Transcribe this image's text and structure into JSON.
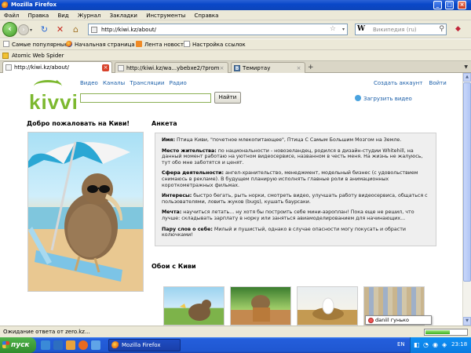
{
  "window": {
    "title": "Mozilla Firefox",
    "minimize": "_",
    "maximize": "□",
    "close": "×"
  },
  "menu": [
    "Файл",
    "Правка",
    "Вид",
    "Журнал",
    "Закладки",
    "Инструменты",
    "Справка"
  ],
  "nav": {
    "url": "http://kiwi.kz/about/",
    "search_engine": "W",
    "search_placeholder": "Википедия (ru)"
  },
  "bookmarks": [
    {
      "label": "Самые популярные",
      "icon": "page-icon"
    },
    {
      "label": "Начальная страница",
      "icon": "firefox-icon"
    },
    {
      "label": "Лента новостей",
      "icon": "rss-icon"
    },
    {
      "label": "Настройка ссылок",
      "icon": "page-icon"
    }
  ],
  "extension": {
    "label": "Atomic Web Spider"
  },
  "tabs": [
    {
      "title": "http://kiwi.kz/about/",
      "active": true
    },
    {
      "title": "http://kiwi.kz/wa...ybebxe2/?promote",
      "active": false
    },
    {
      "title": "Темиртау",
      "active": false
    }
  ],
  "page": {
    "logo": "kivvi",
    "top_nav": [
      "Видео",
      "Каналы",
      "Трансляции",
      "Радио"
    ],
    "account_links": [
      "Создать аккаунт",
      "Войти"
    ],
    "search_button": "Найти",
    "upload_link": "Загрузить видео",
    "welcome_heading": "Добро пожаловать на Киви!",
    "anketa_heading": "Анкета",
    "anketa": [
      {
        "label": "Имя:",
        "text": " Птица Киви, \"почетное млекопитающее\", Птица С Самым Большим Мозгом на Земле."
      },
      {
        "label": "Место жительства:",
        "text": " по национальности - новозеландец, родился в дизайн-студии Whitehill, на данный момент работаю на уютном видеосервисе, названном в честь меня. На жизнь не жалуюсь, тут обо мне заботятся и ценят."
      },
      {
        "label": "Сфера деятельности:",
        "text": " ангел-хранительство, менеджмент, модельный бизнес (с удовольствием снимаюсь в рекламе). В будущем планирую исполнять главные роли в анимационных короткометражных фильмах."
      },
      {
        "label": "Интересы:",
        "text": " быстро бегать, рыть норки, смотреть видео, улучшать работу видеосервиса, общаться с пользователями, ловить жуков (bugs), кушать баурсаки."
      },
      {
        "label": "Мечта:",
        "text": " научиться летать... ну хотя бы построить себе мини-аэроплан! Пока еще не решил, что лучше: складывать зарплату в норку или заняться авиамоделированием для начинающих..."
      },
      {
        "label": "Пару слов о себе:",
        "text": " Милый и пушистый, однако в случае опасности могу покусать и обрасти колючками!"
      }
    ],
    "wallpapers_heading": "Обои с Киви",
    "tooltip": "daniil гунько"
  },
  "status": {
    "text": "Ожидание ответа от zero.kz...",
    "progress": 0.6
  },
  "taskbar": {
    "start": "пуск",
    "task_label": "Mozilla Firefox",
    "lang": "EN",
    "time": "23:18"
  },
  "colors": {
    "accent_green": "#7cb82f",
    "link_blue": "#1a5ea8",
    "xp_blue": "#245edb"
  }
}
